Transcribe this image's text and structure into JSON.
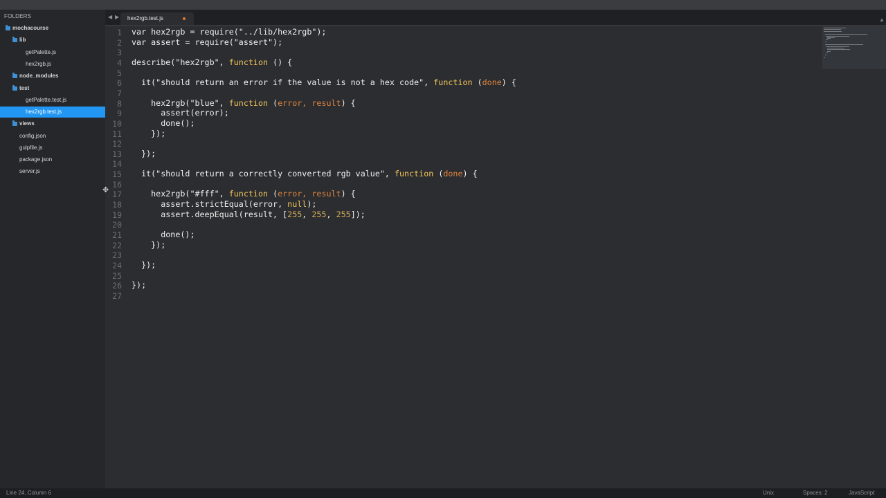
{
  "sidebar": {
    "header": "FOLDERS",
    "items": [
      {
        "label": "mochacourse",
        "type": "folder"
      },
      {
        "label": "lib",
        "type": "folder"
      },
      {
        "label": "getPalette.js",
        "type": "file"
      },
      {
        "label": "hex2rgb.js",
        "type": "file"
      },
      {
        "label": "node_modules",
        "type": "folder"
      },
      {
        "label": "test",
        "type": "folder"
      },
      {
        "label": "getPalette.test.js",
        "type": "file"
      },
      {
        "label": "hex2rgb.test.js",
        "type": "file",
        "selected": true
      },
      {
        "label": "views",
        "type": "folder"
      },
      {
        "label": "config.json",
        "type": "file"
      },
      {
        "label": "gulpfile.js",
        "type": "file"
      },
      {
        "label": "package.json",
        "type": "file"
      },
      {
        "label": "server.js",
        "type": "file"
      }
    ]
  },
  "tabs": {
    "nav_back": "◀",
    "nav_forward": "▶",
    "active_tab": "hex2rgb.test.js",
    "modified_icon": "modified-dot-icon"
  },
  "editor": {
    "line_numbers": [
      "1",
      "2",
      "3",
      "4",
      "5",
      "6",
      "7",
      "8",
      "9",
      "10",
      "11",
      "12",
      "13",
      "14",
      "15",
      "16",
      "17",
      "18",
      "19",
      "20",
      "21",
      "22",
      "23",
      "24",
      "25",
      "26",
      "27"
    ],
    "lines": [
      [
        {
          "t": "var hex2rgb = require(\"../lib/hex2rgb\");"
        }
      ],
      [
        {
          "t": "var assert = require(\"assert\");"
        }
      ],
      [],
      [
        {
          "t": "describe(\"hex2rgb\", "
        },
        {
          "t": "function",
          "c": "kw"
        },
        {
          "t": " () {"
        }
      ],
      [],
      [
        {
          "t": "  it(\"should return an error if the value is not a hex code\", "
        },
        {
          "t": "function",
          "c": "kw"
        },
        {
          "t": " ("
        },
        {
          "t": "done",
          "c": "param"
        },
        {
          "t": ") {"
        }
      ],
      [],
      [
        {
          "t": "    hex2rgb(\"blue\", "
        },
        {
          "t": "function",
          "c": "kw"
        },
        {
          "t": " ("
        },
        {
          "t": "error, result",
          "c": "param"
        },
        {
          "t": ") {"
        }
      ],
      [
        {
          "t": "      assert(error);"
        }
      ],
      [
        {
          "t": "      done();"
        }
      ],
      [
        {
          "t": "    });"
        }
      ],
      [],
      [
        {
          "t": "  });"
        }
      ],
      [],
      [
        {
          "t": "  it(\"should return a correctly converted rgb value\", "
        },
        {
          "t": "function",
          "c": "kw"
        },
        {
          "t": " ("
        },
        {
          "t": "done",
          "c": "param"
        },
        {
          "t": ") {"
        }
      ],
      [],
      [
        {
          "t": "    hex2rgb(\"#fff\", "
        },
        {
          "t": "function",
          "c": "kw"
        },
        {
          "t": " ("
        },
        {
          "t": "error, result",
          "c": "param"
        },
        {
          "t": ") {"
        }
      ],
      [
        {
          "t": "      assert.strictEqual(error, "
        },
        {
          "t": "null",
          "c": "kw"
        },
        {
          "t": ");"
        }
      ],
      [
        {
          "t": "      assert.deepEqual(result, ["
        },
        {
          "t": "255",
          "c": "num"
        },
        {
          "t": ", "
        },
        {
          "t": "255",
          "c": "num"
        },
        {
          "t": ", "
        },
        {
          "t": "255",
          "c": "num"
        },
        {
          "t": "]);"
        }
      ],
      [],
      [
        {
          "t": "      done();"
        }
      ],
      [
        {
          "t": "    });"
        }
      ],
      [],
      [
        {
          "t": "  });"
        }
      ],
      [],
      [
        {
          "t": "});"
        }
      ],
      []
    ]
  },
  "statusbar": {
    "position": "Line 24, Column 6",
    "line_endings": "Unix",
    "indentation": "Spaces: 2",
    "syntax": "JavaScript"
  },
  "colors": {
    "selection": "#2196f3",
    "keyword": "#f2c45c",
    "parameter": "#e2853e",
    "folder": "#3f8fd6"
  }
}
